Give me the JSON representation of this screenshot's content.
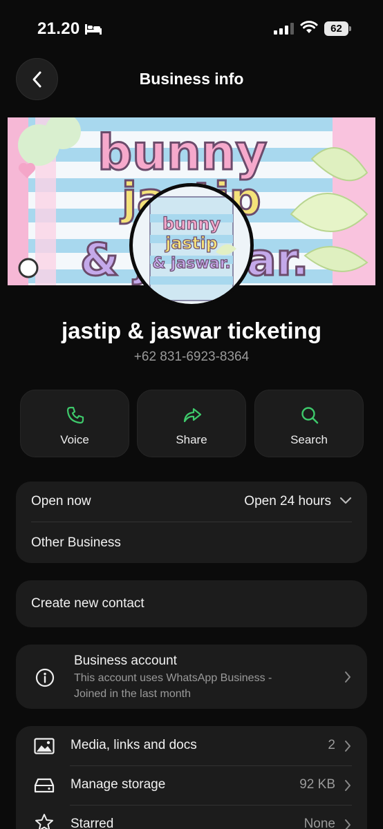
{
  "status_bar": {
    "time": "21.20",
    "battery": "62"
  },
  "header": {
    "title": "Business info"
  },
  "profile": {
    "cover_logo_lines": [
      "bunny",
      "jastip",
      "& jaswar."
    ],
    "name": "jastip & jaswar ticketing",
    "phone": "+62 831-6923-8364"
  },
  "actions": [
    {
      "label": "Voice",
      "icon": "phone-icon"
    },
    {
      "label": "Share",
      "icon": "share-icon"
    },
    {
      "label": "Search",
      "icon": "search-icon"
    }
  ],
  "hours": {
    "status": "Open now",
    "value": "Open 24 hours",
    "category": "Other Business"
  },
  "contact": {
    "create_label": "Create new contact"
  },
  "business_account": {
    "title": "Business account",
    "line1": "This account uses WhatsApp Business -",
    "line2": "Joined in the last month"
  },
  "menu": [
    {
      "label": "Media, links and docs",
      "value": "2",
      "icon": "image-icon"
    },
    {
      "label": "Manage storage",
      "value": "92 KB",
      "icon": "storage-icon"
    },
    {
      "label": "Starred",
      "value": "None",
      "icon": "star-icon"
    }
  ],
  "colors": {
    "accent": "#3ec96b",
    "background": "#0b0b0b",
    "card": "#1c1c1c"
  }
}
